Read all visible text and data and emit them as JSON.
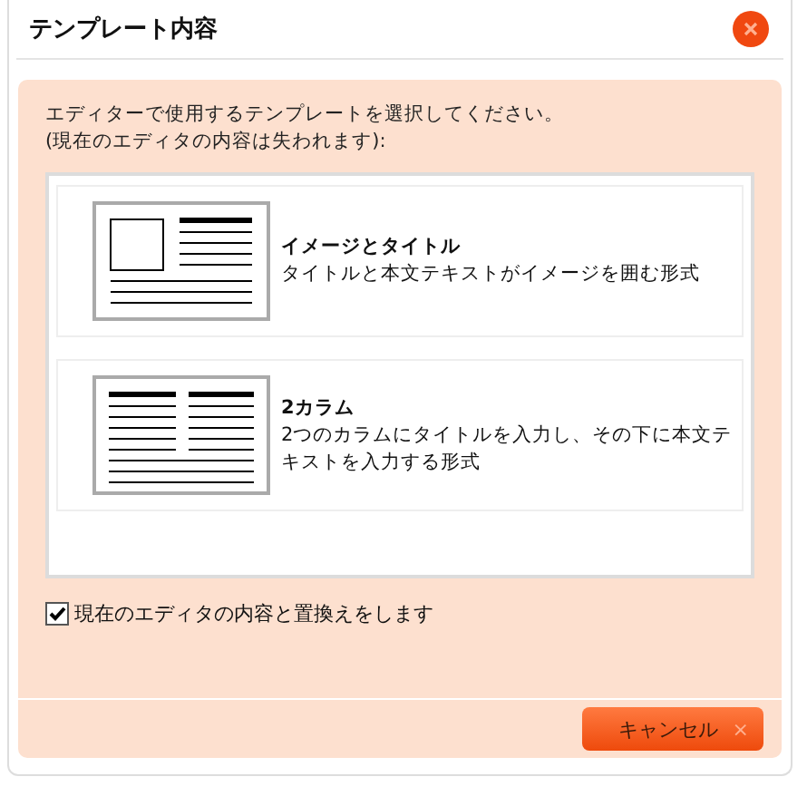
{
  "window": {
    "title": "テンプレート内容"
  },
  "instructions": [
    "エディターで使用するテンプレートを選択してください。",
    "(現在のエディタの内容は失われます):"
  ],
  "templates": [
    {
      "kind": "image-title",
      "title": "イメージとタイトル",
      "description": "タイトルと本文テキストがイメージを囲む形式"
    },
    {
      "kind": "two-column",
      "title": "2カラム",
      "description": "2つのカラムにタイトルを入力し、その下に本文テキストを入力する形式"
    }
  ],
  "replace_option": {
    "label": "現在のエディタの内容と置換えをします",
    "checked": true
  },
  "cancel_button": {
    "label": "キャンセル",
    "icon": "×"
  }
}
